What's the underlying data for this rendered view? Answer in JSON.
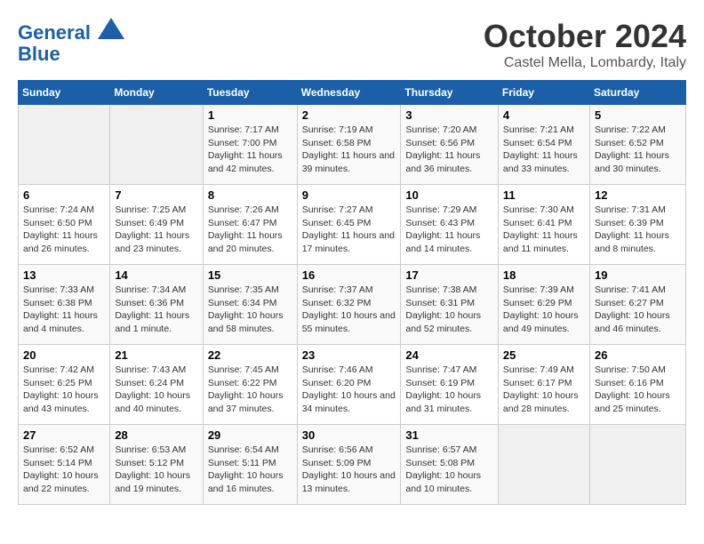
{
  "header": {
    "logo_line1": "General",
    "logo_line2": "Blue",
    "month": "October 2024",
    "location": "Castel Mella, Lombardy, Italy"
  },
  "weekdays": [
    "Sunday",
    "Monday",
    "Tuesday",
    "Wednesday",
    "Thursday",
    "Friday",
    "Saturday"
  ],
  "weeks": [
    [
      null,
      null,
      {
        "day": 1,
        "sunrise": "7:17 AM",
        "sunset": "7:00 PM",
        "daylight": "11 hours and 42 minutes."
      },
      {
        "day": 2,
        "sunrise": "7:19 AM",
        "sunset": "6:58 PM",
        "daylight": "11 hours and 39 minutes."
      },
      {
        "day": 3,
        "sunrise": "7:20 AM",
        "sunset": "6:56 PM",
        "daylight": "11 hours and 36 minutes."
      },
      {
        "day": 4,
        "sunrise": "7:21 AM",
        "sunset": "6:54 PM",
        "daylight": "11 hours and 33 minutes."
      },
      {
        "day": 5,
        "sunrise": "7:22 AM",
        "sunset": "6:52 PM",
        "daylight": "11 hours and 30 minutes."
      }
    ],
    [
      {
        "day": 6,
        "sunrise": "7:24 AM",
        "sunset": "6:50 PM",
        "daylight": "11 hours and 26 minutes."
      },
      {
        "day": 7,
        "sunrise": "7:25 AM",
        "sunset": "6:49 PM",
        "daylight": "11 hours and 23 minutes."
      },
      {
        "day": 8,
        "sunrise": "7:26 AM",
        "sunset": "6:47 PM",
        "daylight": "11 hours and 20 minutes."
      },
      {
        "day": 9,
        "sunrise": "7:27 AM",
        "sunset": "6:45 PM",
        "daylight": "11 hours and 17 minutes."
      },
      {
        "day": 10,
        "sunrise": "7:29 AM",
        "sunset": "6:43 PM",
        "daylight": "11 hours and 14 minutes."
      },
      {
        "day": 11,
        "sunrise": "7:30 AM",
        "sunset": "6:41 PM",
        "daylight": "11 hours and 11 minutes."
      },
      {
        "day": 12,
        "sunrise": "7:31 AM",
        "sunset": "6:39 PM",
        "daylight": "11 hours and 8 minutes."
      }
    ],
    [
      {
        "day": 13,
        "sunrise": "7:33 AM",
        "sunset": "6:38 PM",
        "daylight": "11 hours and 4 minutes."
      },
      {
        "day": 14,
        "sunrise": "7:34 AM",
        "sunset": "6:36 PM",
        "daylight": "11 hours and 1 minute."
      },
      {
        "day": 15,
        "sunrise": "7:35 AM",
        "sunset": "6:34 PM",
        "daylight": "10 hours and 58 minutes."
      },
      {
        "day": 16,
        "sunrise": "7:37 AM",
        "sunset": "6:32 PM",
        "daylight": "10 hours and 55 minutes."
      },
      {
        "day": 17,
        "sunrise": "7:38 AM",
        "sunset": "6:31 PM",
        "daylight": "10 hours and 52 minutes."
      },
      {
        "day": 18,
        "sunrise": "7:39 AM",
        "sunset": "6:29 PM",
        "daylight": "10 hours and 49 minutes."
      },
      {
        "day": 19,
        "sunrise": "7:41 AM",
        "sunset": "6:27 PM",
        "daylight": "10 hours and 46 minutes."
      }
    ],
    [
      {
        "day": 20,
        "sunrise": "7:42 AM",
        "sunset": "6:25 PM",
        "daylight": "10 hours and 43 minutes."
      },
      {
        "day": 21,
        "sunrise": "7:43 AM",
        "sunset": "6:24 PM",
        "daylight": "10 hours and 40 minutes."
      },
      {
        "day": 22,
        "sunrise": "7:45 AM",
        "sunset": "6:22 PM",
        "daylight": "10 hours and 37 minutes."
      },
      {
        "day": 23,
        "sunrise": "7:46 AM",
        "sunset": "6:20 PM",
        "daylight": "10 hours and 34 minutes."
      },
      {
        "day": 24,
        "sunrise": "7:47 AM",
        "sunset": "6:19 PM",
        "daylight": "10 hours and 31 minutes."
      },
      {
        "day": 25,
        "sunrise": "7:49 AM",
        "sunset": "6:17 PM",
        "daylight": "10 hours and 28 minutes."
      },
      {
        "day": 26,
        "sunrise": "7:50 AM",
        "sunset": "6:16 PM",
        "daylight": "10 hours and 25 minutes."
      }
    ],
    [
      {
        "day": 27,
        "sunrise": "6:52 AM",
        "sunset": "5:14 PM",
        "daylight": "10 hours and 22 minutes."
      },
      {
        "day": 28,
        "sunrise": "6:53 AM",
        "sunset": "5:12 PM",
        "daylight": "10 hours and 19 minutes."
      },
      {
        "day": 29,
        "sunrise": "6:54 AM",
        "sunset": "5:11 PM",
        "daylight": "10 hours and 16 minutes."
      },
      {
        "day": 30,
        "sunrise": "6:56 AM",
        "sunset": "5:09 PM",
        "daylight": "10 hours and 13 minutes."
      },
      {
        "day": 31,
        "sunrise": "6:57 AM",
        "sunset": "5:08 PM",
        "daylight": "10 hours and 10 minutes."
      },
      null,
      null
    ]
  ]
}
